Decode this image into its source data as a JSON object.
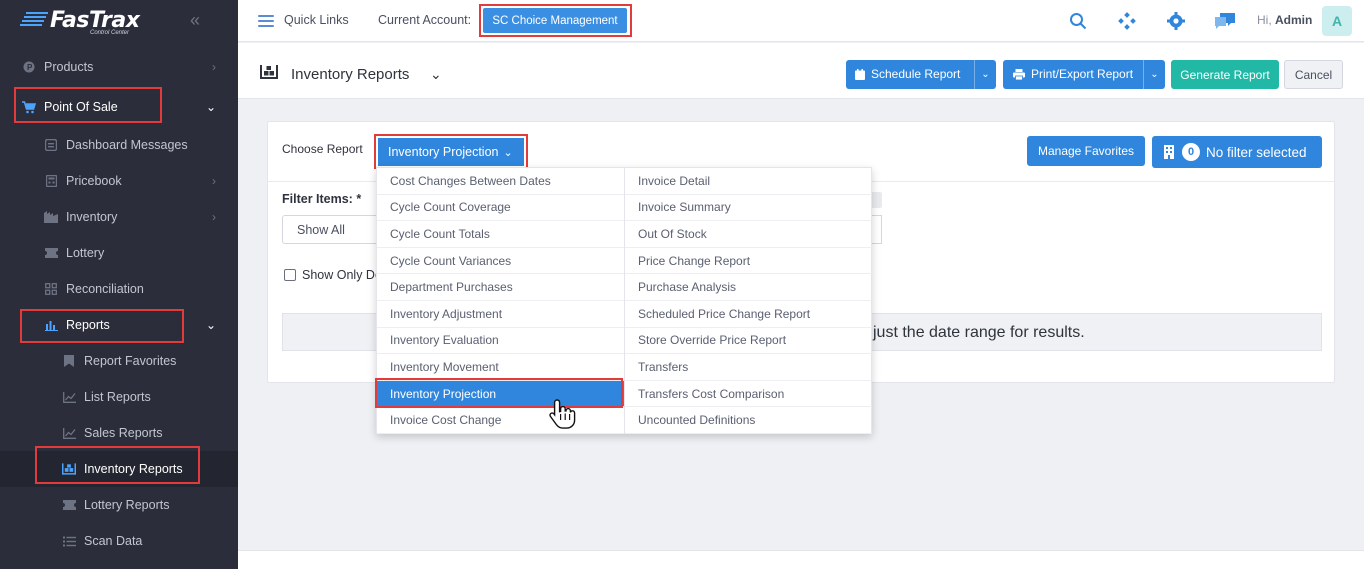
{
  "brand": {
    "name": "FasTrax",
    "tagline": "Control Center"
  },
  "sidebar": {
    "items": [
      {
        "label": "Products",
        "icon": "products-icon",
        "chevron": "›"
      },
      {
        "label": "Point Of Sale",
        "icon": "cart-icon",
        "chevron": "⌄"
      },
      {
        "label": "Dashboard Messages",
        "icon": "message-icon",
        "chevron": ""
      },
      {
        "label": "Pricebook",
        "icon": "calculator-icon",
        "chevron": "›"
      },
      {
        "label": "Inventory",
        "icon": "inventory-icon",
        "chevron": "›"
      },
      {
        "label": "Lottery",
        "icon": "ticket-icon",
        "chevron": ""
      },
      {
        "label": "Reconciliation",
        "icon": "grid-icon",
        "chevron": ""
      },
      {
        "label": "Reports",
        "icon": "bar-chart-icon",
        "chevron": "⌄"
      },
      {
        "label": "Report Favorites",
        "icon": "bookmark-icon",
        "chevron": ""
      },
      {
        "label": "List Reports",
        "icon": "line-chart-icon",
        "chevron": ""
      },
      {
        "label": "Sales Reports",
        "icon": "line-chart-icon",
        "chevron": ""
      },
      {
        "label": "Inventory Reports",
        "icon": "warehouse-icon",
        "chevron": ""
      },
      {
        "label": "Lottery Reports",
        "icon": "ticket-icon",
        "chevron": ""
      },
      {
        "label": "Scan Data",
        "icon": "list-icon",
        "chevron": ""
      }
    ]
  },
  "topbar": {
    "quick_links": "Quick Links",
    "current_account_label": "Current Account:",
    "current_account": "SC Choice Management",
    "greeting": "Hi,",
    "user": "Admin",
    "avatar_initial": "A"
  },
  "page": {
    "title": "Inventory Reports",
    "schedule_label": "Schedule Report",
    "print_label": "Print/Export Report",
    "generate_label": "Generate Report",
    "cancel_label": "Cancel"
  },
  "card": {
    "choose_label": "Choose Report",
    "selected_report": "Inventory Projection",
    "manage_favorites": "Manage Favorites",
    "filter_count": "0",
    "filter_label": "No filter selected",
    "filter_items_label": "Filter Items: *",
    "show_all": "Show All",
    "show_only_label": "Show Only De",
    "message_fragment": "just the date range for results."
  },
  "dropdown": {
    "col1": [
      "Cost Changes Between Dates",
      "Cycle Count Coverage",
      "Cycle Count Totals",
      "Cycle Count Variances",
      "Department Purchases",
      "Inventory Adjustment",
      "Inventory Evaluation",
      "Inventory Movement",
      "Inventory Projection",
      "Invoice Cost Change"
    ],
    "col2": [
      "Invoice Detail",
      "Invoice Summary",
      "Out Of Stock",
      "Price Change Report",
      "Purchase Analysis",
      "Scheduled Price Change Report",
      "Store Override Price Report",
      "Transfers",
      "Transfers Cost Comparison",
      "Uncounted Definitions"
    ],
    "selected": "Inventory Projection"
  },
  "colors": {
    "accent": "#2f86dc",
    "teal": "#21b9a6",
    "sidebar": "#2b2e3a",
    "highlight": "#e23b3b"
  }
}
